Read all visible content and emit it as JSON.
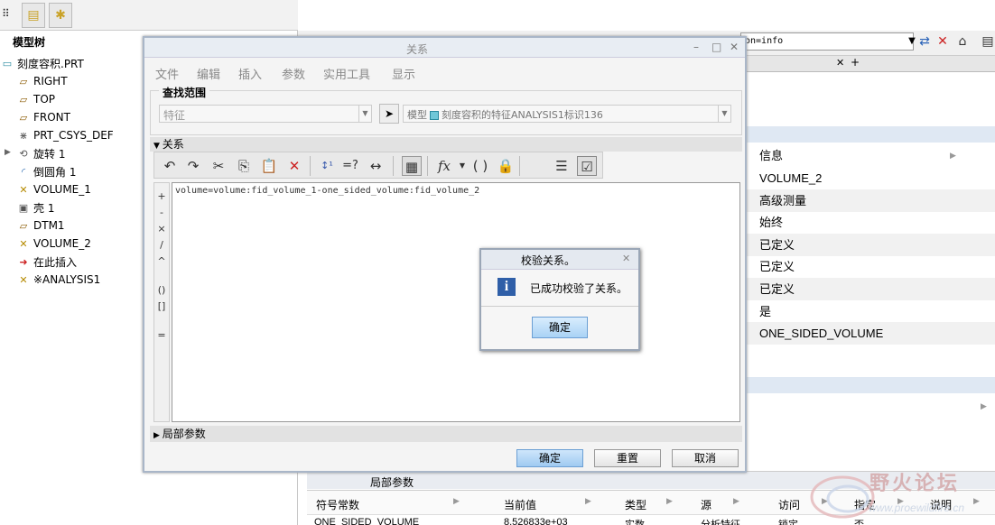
{
  "model_tree": {
    "title": "模型树",
    "items": [
      {
        "label": "刻度容积.PRT",
        "icon": "part-icon"
      },
      {
        "label": "RIGHT",
        "icon": "datum-plane-icon"
      },
      {
        "label": "TOP",
        "icon": "datum-plane-icon"
      },
      {
        "label": "FRONT",
        "icon": "datum-plane-icon"
      },
      {
        "label": "PRT_CSYS_DEF",
        "icon": "csys-icon"
      },
      {
        "label": "旋转 1",
        "icon": "revolve-icon"
      },
      {
        "label": "倒圆角 1",
        "icon": "round-icon"
      },
      {
        "label": "VOLUME_1",
        "icon": "analysis-icon"
      },
      {
        "label": "壳 1",
        "icon": "shell-icon"
      },
      {
        "label": "DTM1",
        "icon": "datum-plane-icon"
      },
      {
        "label": "VOLUME_2",
        "icon": "analysis-icon"
      },
      {
        "label": "在此插入",
        "icon": "insert-here-icon"
      },
      {
        "label": "※ANALYSIS1",
        "icon": "analysis-icon"
      }
    ]
  },
  "browser": {
    "address_fragment": "on=info"
  },
  "info_panel": {
    "header": "信息",
    "rows": [
      "VOLUME_2",
      "高级测量",
      "始终",
      "已定义",
      "已定义",
      "已定义",
      "是",
      "ONE_SIDED_VOLUME"
    ]
  },
  "relations_dialog": {
    "title": "关系",
    "menus": [
      "文件",
      "编辑",
      "插入",
      "参数",
      "实用工具",
      "显示"
    ],
    "search_scope_label": "查找范围",
    "scope_select": "特征",
    "scope_target_prefix": "模型",
    "scope_target": "刻度容积的特征ANALYSIS1标识136",
    "relations_section": "关系",
    "relation_text": "volume=volume:fid_volume_1-one_sided_volume:fid_volume_2",
    "side_ops": [
      "+",
      "-",
      "×",
      "/",
      "^",
      "()",
      "[]",
      "="
    ],
    "local_params_section": "局部参数",
    "ok_label": "确定",
    "reset_label": "重置",
    "cancel_label": "取消"
  },
  "verify_dialog": {
    "title": "校验关系。",
    "message": "已成功校验了关系。",
    "ok_label": "确定"
  },
  "local_params": {
    "title": "局部参数",
    "columns": [
      "符号常数",
      "当前值",
      "类型",
      "源",
      "访问",
      "指定",
      "说明"
    ],
    "row": [
      "ONE_SIDED_VOLUME",
      "8.526833e+03",
      "实数",
      "分析特征",
      "锁定",
      "否"
    ]
  },
  "watermark": {
    "text": "野火论坛",
    "url": "www.proewildfire.cn"
  }
}
